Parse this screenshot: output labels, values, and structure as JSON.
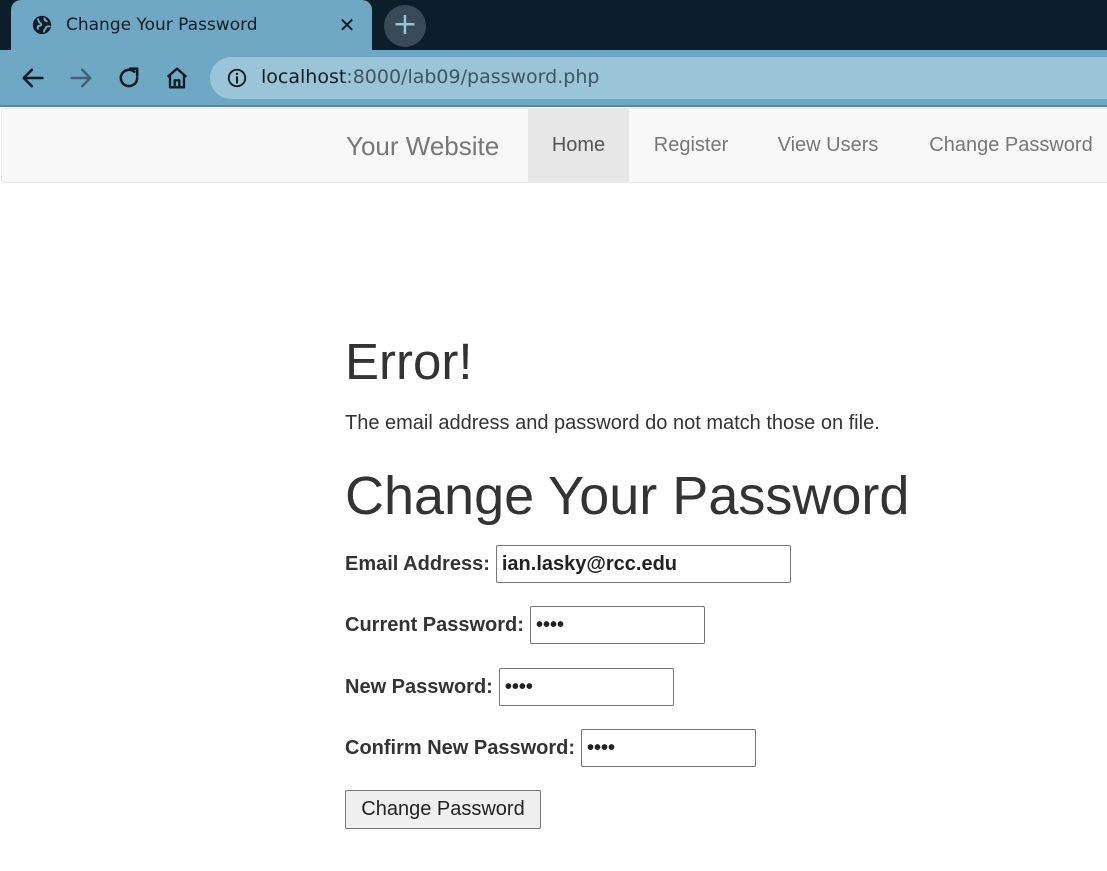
{
  "browser": {
    "tab_title": "Change Your Password",
    "close_glyph": "✕",
    "new_tab_glyph": "+",
    "url_host": "localhost",
    "url_rest": ":8000/lab09/password.php",
    "icons": [
      "globe-icon",
      "close-icon",
      "plus-icon",
      "back-arrow-icon",
      "forward-arrow-icon",
      "reload-icon",
      "home-icon",
      "info-icon"
    ]
  },
  "navbar": {
    "brand": "Your Website",
    "items": [
      {
        "label": "Home",
        "active": true
      },
      {
        "label": "Register",
        "active": false
      },
      {
        "label": "View Users",
        "active": false
      },
      {
        "label": "Change Password",
        "active": false
      }
    ]
  },
  "error": {
    "title": "Error!",
    "message": "The email address and password do not match those on file."
  },
  "form": {
    "title": "Change Your Password",
    "email_label": "Email Address:",
    "email_value": "ian.lasky@rcc.edu",
    "current_label": "Current Password:",
    "current_value": "••••",
    "new_label": "New Password:",
    "new_value": "••••",
    "confirm_label": "Confirm New Password:",
    "confirm_value": "••••",
    "submit_label": "Change Password"
  },
  "colors": {
    "tabstrip": "#0c1e2a",
    "toolbar": "#6fa8c4",
    "omnibox": "#9ac5d9",
    "navbar_bg": "#f8f8f8",
    "nav_active": "#e7e7e7",
    "text": "#333333"
  }
}
